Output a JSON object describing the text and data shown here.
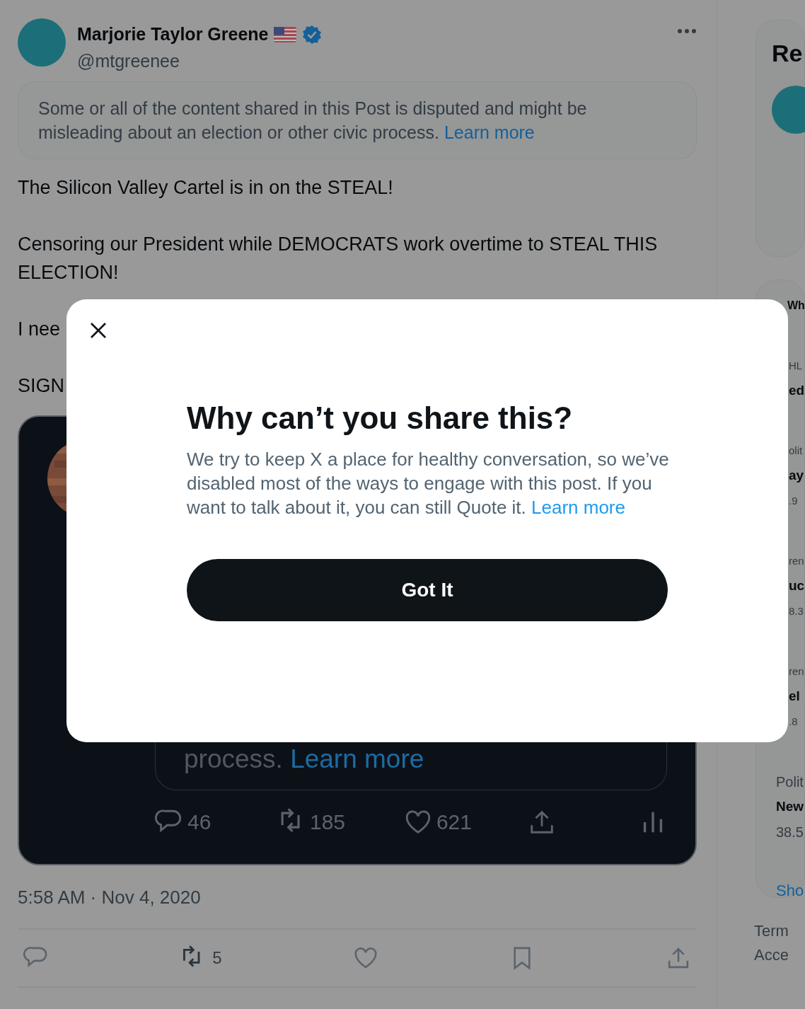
{
  "post": {
    "author": {
      "name": "Marjorie Taylor Greene",
      "handle": "@mtgreenee",
      "verified": true
    },
    "notice": {
      "text": "Some or all of the content shared in this Post is disputed and might be misleading about an election or other civic process.",
      "link": "Learn more"
    },
    "paragraphs": [
      "The Silicon Valley Cartel is in on the STEAL!",
      "Censoring our President while DEMOCRATS work overtime to STEAL THIS ELECTION!",
      "I nee",
      "SIGN"
    ],
    "embedded": {
      "notice_text": "process.",
      "notice_link": "Learn more",
      "stats": [
        {
          "kind": "reply",
          "count": "46"
        },
        {
          "kind": "repost",
          "count": "185"
        },
        {
          "kind": "like",
          "count": "621"
        },
        {
          "kind": "share"
        },
        {
          "kind": "views"
        }
      ]
    },
    "timestamp": "5:58 AM · Nov 4, 2020",
    "actions": [
      {
        "kind": "reply"
      },
      {
        "kind": "repost",
        "count": "5"
      },
      {
        "kind": "like"
      },
      {
        "kind": "bookmark"
      },
      {
        "kind": "share"
      }
    ]
  },
  "sidebar": {
    "relevant_title": "Re",
    "trends_title": "Wh",
    "trends": [
      {
        "category": "HL",
        "title": "ed"
      },
      {
        "category": "olit",
        "title": "ay",
        "count": ".9"
      },
      {
        "category": "ren",
        "title": "uc",
        "count": "8.3"
      },
      {
        "category": "ren",
        "title": "el",
        "count": ".8"
      },
      {
        "category": "Polit",
        "title": "New",
        "count": "38.5"
      }
    ],
    "show_more": "Sho",
    "footer": [
      "Term",
      "Acce"
    ]
  },
  "dialog": {
    "title": "Why can’t you share this?",
    "body": "We try to keep X a place for healthy conversation, so we’ve disabled most of the ways to engage with this post. If you want to talk about it, you can still Quote it.",
    "link": "Learn more",
    "button": "Got It"
  }
}
